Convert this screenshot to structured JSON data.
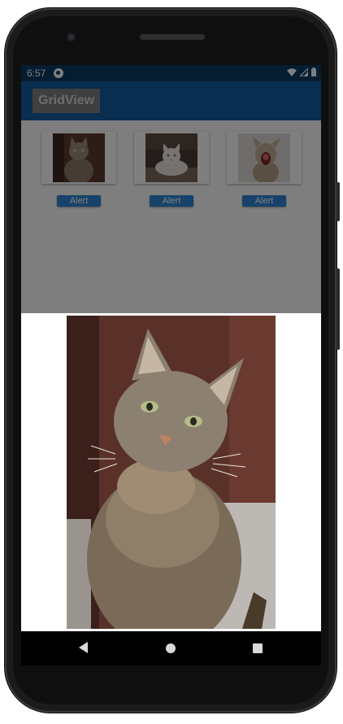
{
  "status_bar": {
    "time": "6:57",
    "icons": [
      "app-notification-icon",
      "wifi-icon",
      "cellular-signal-icon",
      "battery-icon"
    ]
  },
  "app_bar": {
    "title": "GridView",
    "color": "#145d9e"
  },
  "grid": {
    "items": [
      {
        "image": "cat-sitting-thumbnail",
        "button_label": "Alert"
      },
      {
        "image": "white-cat-lying-thumbnail",
        "button_label": "Alert"
      },
      {
        "image": "cat-yawning-thumbnail",
        "button_label": "Alert"
      }
    ]
  },
  "dialog": {
    "image": "tabby-cat-full-image"
  },
  "nav_bar": {
    "buttons": [
      "back-icon",
      "home-icon",
      "recents-icon"
    ]
  },
  "colors": {
    "status_bar": "#0b3a63",
    "accent_button": "#2f86d4",
    "overlay": "rgba(0,0,0,0.5)"
  }
}
